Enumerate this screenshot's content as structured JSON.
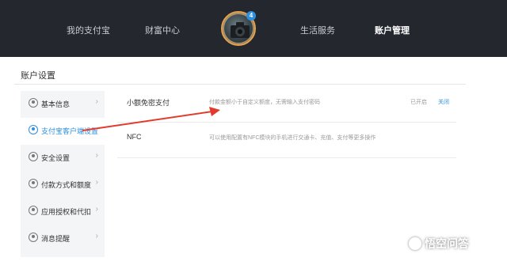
{
  "nav": {
    "items": [
      {
        "label": "我的支付宝",
        "active": false
      },
      {
        "label": "财富中心",
        "active": false
      },
      {
        "label": "生活服务",
        "active": false
      },
      {
        "label": "账户管理",
        "active": true
      }
    ],
    "avatar_badge": "4"
  },
  "page": {
    "title": "账户设置"
  },
  "sidebar": {
    "items": [
      {
        "label": "基本信息",
        "icon": "user-icon"
      },
      {
        "label": "支付宝客户端设置",
        "icon": "settings-icon",
        "active": true
      },
      {
        "label": "安全设置",
        "icon": "lock-icon"
      },
      {
        "label": "付款方式和额度",
        "icon": "yuan-icon"
      },
      {
        "label": "应用授权和代扣",
        "icon": "check-icon"
      },
      {
        "label": "消息提醒",
        "icon": "message-icon"
      }
    ],
    "chevron": "›"
  },
  "settings": {
    "rows": [
      {
        "label": "小额免密支付",
        "desc": "付款金额小于自定义额度，无需输入支付密码",
        "status": "已开启",
        "action": "关闭"
      },
      {
        "label": "NFC",
        "desc": "可以使用配置有NFC模块的手机进行交通卡、充值、支付等更多操作",
        "status": "",
        "action": ""
      }
    ]
  },
  "colors": {
    "accent": "#2d8fe0",
    "nav_bg": "#24272e",
    "annotation": "#e23b2e"
  },
  "watermark": {
    "text": "悟空问答"
  }
}
